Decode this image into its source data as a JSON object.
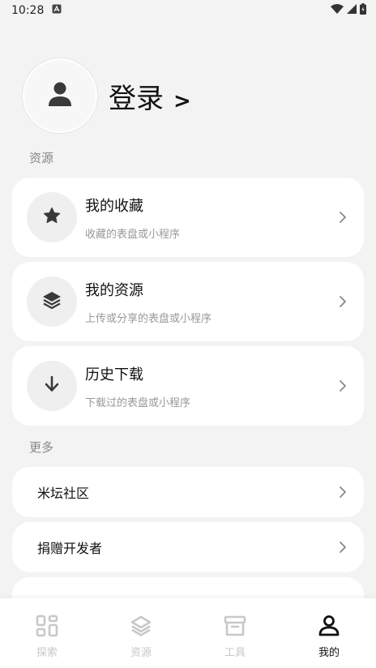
{
  "status_bar": {
    "time": "10:28"
  },
  "profile": {
    "login_label": "登录",
    "login_arrow": ">"
  },
  "sections": {
    "resources_title": "资源",
    "more_title": "更多"
  },
  "resource_cards": [
    {
      "title": "我的收藏",
      "subtitle": "收藏的表盘或小程序",
      "icon": "star-icon"
    },
    {
      "title": "我的资源",
      "subtitle": "上传或分享的表盘或小程序",
      "icon": "layers-icon"
    },
    {
      "title": "历史下载",
      "subtitle": "下载过的表盘或小程序",
      "icon": "download-arrow-icon"
    }
  ],
  "more_items": [
    {
      "title": "米坛社区"
    },
    {
      "title": "捐赠开发者"
    }
  ],
  "bottom_nav": [
    {
      "label": "探索",
      "icon": "grid-icon",
      "active": false
    },
    {
      "label": "资源",
      "icon": "layers-icon",
      "active": false
    },
    {
      "label": "工具",
      "icon": "archive-box-icon",
      "active": false
    },
    {
      "label": "我的",
      "icon": "user-icon",
      "active": true
    }
  ],
  "colors": {
    "background": "#f3f3f3",
    "card": "#ffffff",
    "icon_bg": "#efefef",
    "active": "#111111",
    "inactive": "#c8c8c8"
  }
}
